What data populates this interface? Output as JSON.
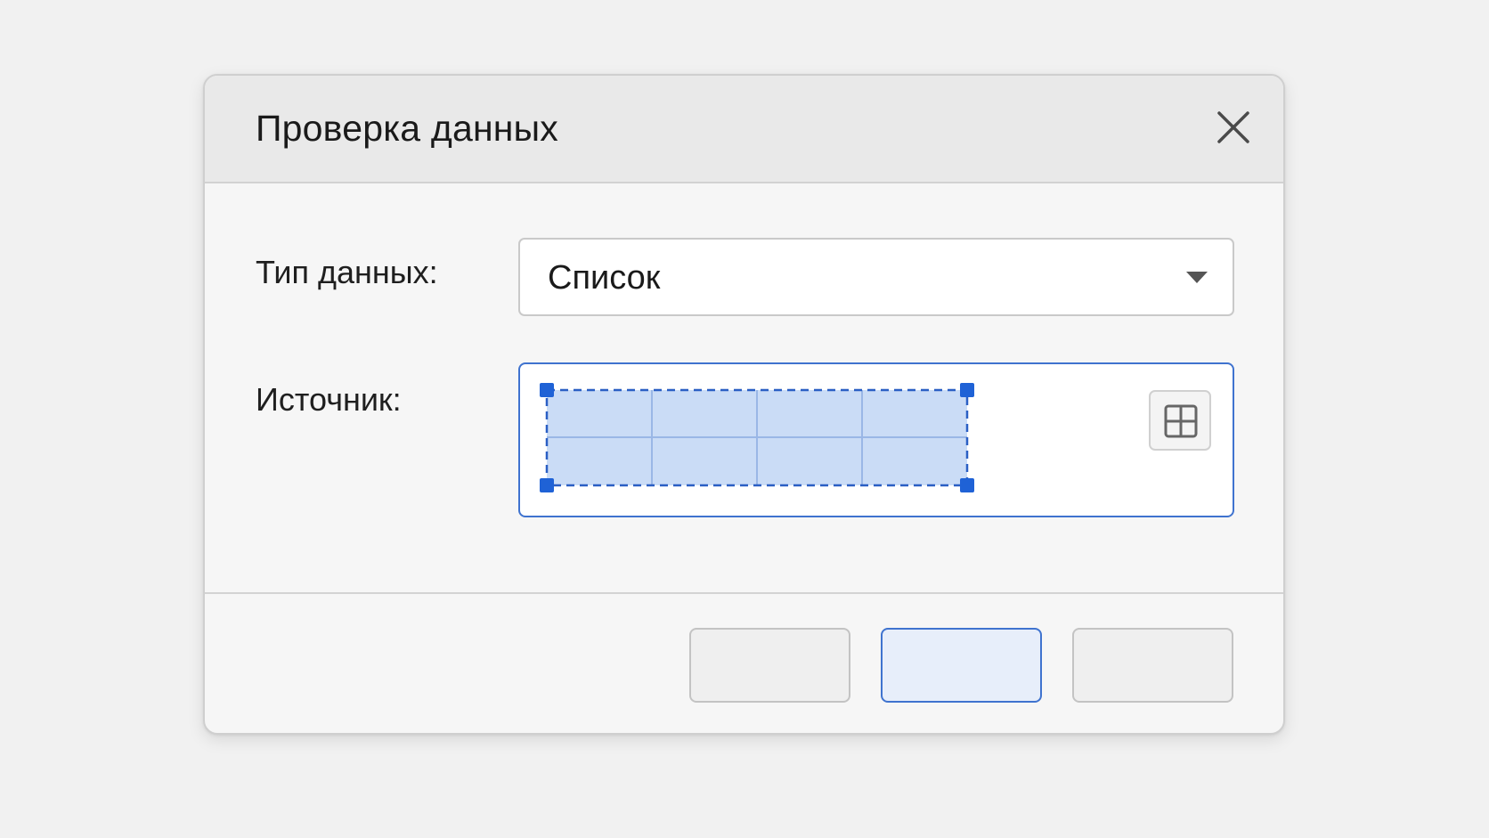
{
  "dialog": {
    "title": "Проверка данных",
    "close_icon": "close-icon"
  },
  "form": {
    "type_label": "Тип данных:",
    "type_value": "Список",
    "type_caret_icon": "caret-down-icon",
    "source_label": "Источник:",
    "source_value": "",
    "range_selection": {
      "rows": 2,
      "cols": 4
    },
    "range_picker_icon": "grid-select-icon"
  },
  "footer": {
    "buttons": [
      {
        "label": ""
      },
      {
        "label": ""
      },
      {
        "label": ""
      }
    ]
  },
  "colors": {
    "accent": "#3f73cf",
    "selection_fill": "#cadcf6",
    "handle": "#1f62d6"
  }
}
